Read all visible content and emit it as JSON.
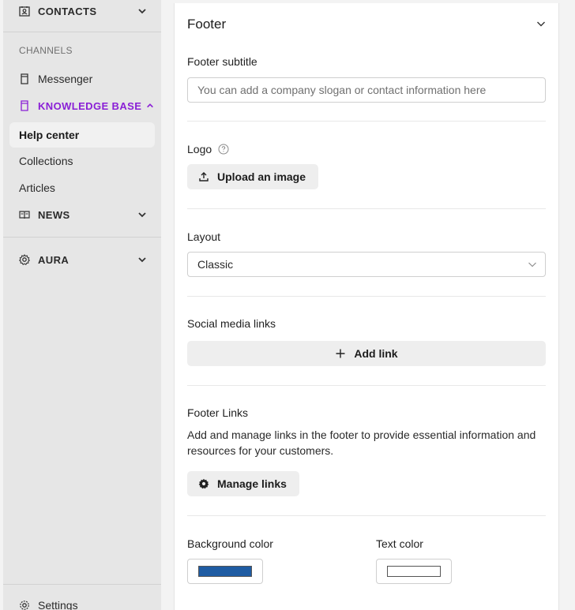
{
  "sidebar": {
    "contacts": "CONTACTS",
    "channels_header": "CHANNELS",
    "messenger": "Messenger",
    "knowledge_base": "KNOWLEDGE BASE",
    "help_center": "Help center",
    "collections": "Collections",
    "articles": "Articles",
    "news": "NEWS",
    "aura": "AURA",
    "settings": "Settings"
  },
  "panel": {
    "title": "Footer",
    "footer_subtitle": {
      "label": "Footer subtitle",
      "placeholder": "You can add a company slogan or contact information here"
    },
    "logo": {
      "label": "Logo",
      "button": "Upload an image"
    },
    "layout": {
      "label": "Layout",
      "value": "Classic"
    },
    "social": {
      "label": "Social media links",
      "button": "Add link"
    },
    "footer_links": {
      "label": "Footer Links",
      "description": "Add and manage links in the footer to provide essential information and resources for your customers.",
      "button": "Manage links"
    },
    "background_color": {
      "label": "Background color",
      "value": "#1f5ca3"
    },
    "text_color": {
      "label": "Text color",
      "value": "#ffffff"
    }
  },
  "colors": {
    "accent": "#8a1fd6",
    "sidebar_bg": "#e6e6e6"
  }
}
